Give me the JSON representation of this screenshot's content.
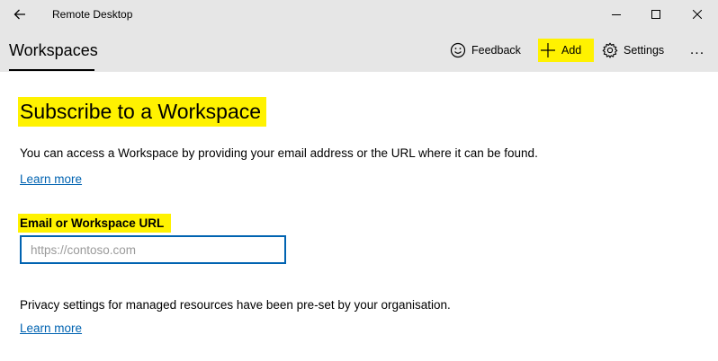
{
  "window": {
    "title": "Remote Desktop"
  },
  "commandbar": {
    "title": "Workspaces",
    "feedback_label": "Feedback",
    "add_label": "Add",
    "settings_label": "Settings",
    "more_label": "..."
  },
  "main": {
    "heading": "Subscribe to a Workspace",
    "description": "You can access a Workspace by providing your email address or the URL where it can be found.",
    "learn_more_1": "Learn more",
    "field_label": "Email or Workspace URL",
    "field_placeholder": "https://contoso.com",
    "field_value": "",
    "privacy_text": "Privacy settings for managed resources have been pre-set by your organisation.",
    "learn_more_2": "Learn more"
  },
  "colors": {
    "chrome_bg": "#e6e6e6",
    "highlight": "#fff200",
    "accent": "#0063b1"
  },
  "icons": {
    "back": "arrow-left-icon",
    "minimize": "minimize-icon",
    "maximize": "maximize-icon",
    "close": "close-icon",
    "feedback": "smiley-icon",
    "add": "plus-icon",
    "settings": "gear-icon",
    "more": "more-dots-icon"
  }
}
